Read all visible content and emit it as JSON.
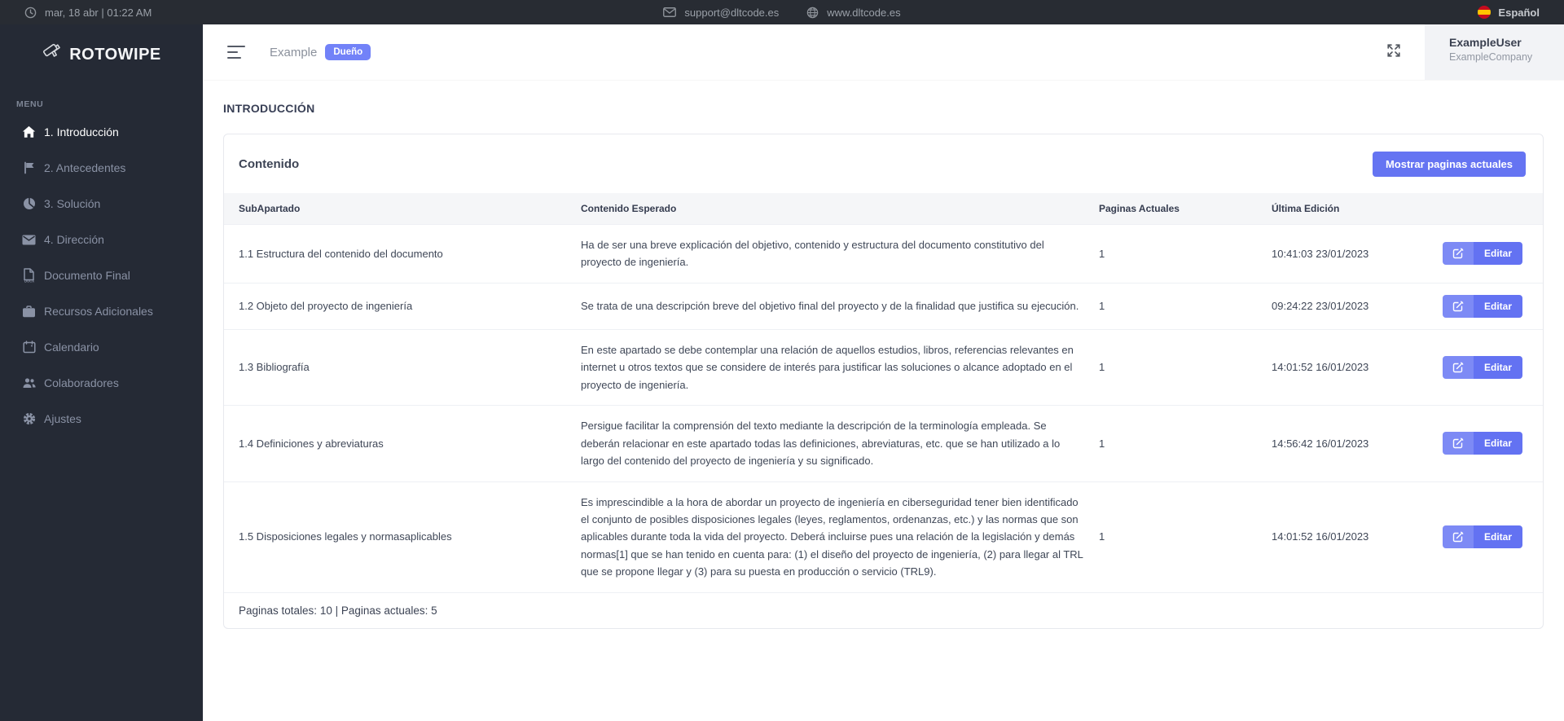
{
  "topbar": {
    "datetime": "mar, 18 abr | 01:22 AM",
    "email": "support@dltcode.es",
    "website": "www.dltcode.es",
    "language": "Español"
  },
  "sidebar": {
    "logo": "ROTOWIPE",
    "menu_label": "MENU",
    "items": [
      {
        "label": "1. Introducción",
        "icon": "home-icon",
        "active": true
      },
      {
        "label": "2. Antecedentes",
        "icon": "flag-icon",
        "active": false
      },
      {
        "label": "3. Solución",
        "icon": "pie-chart-icon",
        "active": false
      },
      {
        "label": "4. Dirección",
        "icon": "mail-icon",
        "active": false
      },
      {
        "label": "Documento Final",
        "icon": "docx-file-icon",
        "active": false
      },
      {
        "label": "Recursos Adicionales",
        "icon": "briefcase-icon",
        "active": false
      },
      {
        "label": "Calendario",
        "icon": "calendar-icon",
        "active": false
      },
      {
        "label": "Colaboradores",
        "icon": "people-icon",
        "active": false
      },
      {
        "label": "Ajustes",
        "icon": "gear-icon",
        "active": false
      }
    ]
  },
  "header": {
    "project_name": "Example",
    "role_badge": "Dueño",
    "user_name": "ExampleUser",
    "company": "ExampleCompany"
  },
  "page": {
    "title": "INTRODUCCIÓN"
  },
  "card": {
    "title": "Contenido",
    "show_pages_button": "Mostrar paginas actuales",
    "footer": "Paginas totales: 10 | Paginas actuales: 5"
  },
  "table": {
    "columns": [
      "SubApartado",
      "Contenido Esperado",
      "Paginas Actuales",
      "Última Edición"
    ],
    "edit_label": "Editar",
    "rows": [
      {
        "subapartado": "1.1 Estructura del contenido del documento",
        "contenido": "Ha de ser una breve explicación del objetivo, contenido y estructura del documento constitutivo del proyecto de ingeniería.",
        "paginas": "1",
        "ultima_edicion": "10:41:03 23/01/2023"
      },
      {
        "subapartado": "1.2 Objeto del proyecto de ingeniería",
        "contenido": "Se trata de una descripción breve del objetivo final del proyecto y de la finalidad que justifica su ejecución.",
        "paginas": "1",
        "ultima_edicion": "09:24:22 23/01/2023"
      },
      {
        "subapartado": "1.3 Bibliografía",
        "contenido": "En este apartado se debe contemplar una relación de aquellos estudios, libros, referencias relevantes en internet u otros textos que se considere de interés para justificar las soluciones o alcance adoptado en el proyecto de ingeniería.",
        "paginas": "1",
        "ultima_edicion": "14:01:52 16/01/2023"
      },
      {
        "subapartado": "1.4 Definiciones y abreviaturas",
        "contenido": "Persigue facilitar la comprensión del texto mediante la descripción de la terminología empleada. Se deberán relacionar en este apartado todas las definiciones, abreviaturas, etc. que se han utilizado a lo largo del contenido del proyecto de ingeniería y su significado.",
        "paginas": "1",
        "ultima_edicion": "14:56:42 16/01/2023"
      },
      {
        "subapartado": "1.5 Disposiciones legales y normasaplicables",
        "contenido": "Es imprescindible a la hora de abordar un proyecto de ingeniería en ciberseguridad tener bien identificado el conjunto de posibles disposiciones legales (leyes, reglamentos, ordenanzas, etc.) y las normas que son aplicables durante toda la vida del proyecto. Deberá incluirse pues una relación de la legislación y demás normas[1] que se han tenido en cuenta para: (1) el diseño del proyecto de ingeniería, (2) para llegar al TRL que se propone llegar y (3) para su puesta en producción o servicio (TRL9).",
        "paginas": "1",
        "ultima_edicion": "14:01:52 16/01/2023"
      }
    ]
  },
  "colors": {
    "accent": "#6574f2",
    "badge": "#7282f8",
    "topbar_bg": "#282c33",
    "sidebar_bg": "#252a35",
    "flag_red": "#c60b1e",
    "flag_yellow": "#ffc400"
  }
}
